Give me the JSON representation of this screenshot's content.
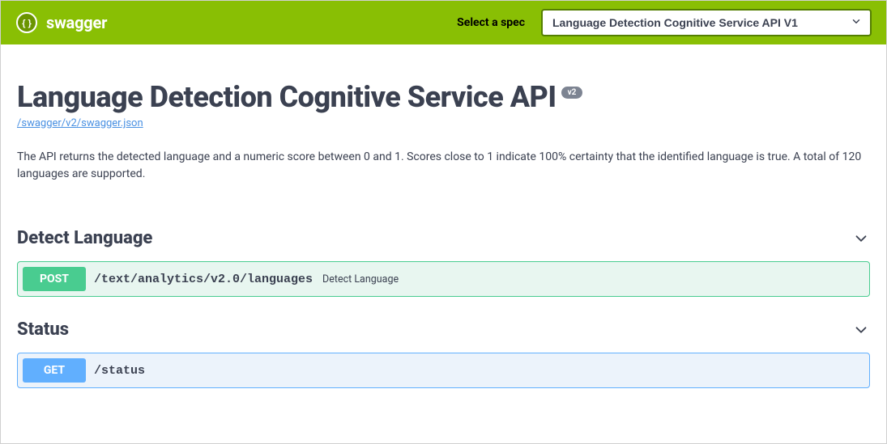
{
  "topbar": {
    "brand": "swagger",
    "spec_label": "Select a spec",
    "spec_selected": "Language Detection Cognitive Service API V1"
  },
  "info": {
    "title": "Language Detection Cognitive Service API",
    "version": "v2",
    "swagger_json_url": "/swagger/v2/swagger.json",
    "description": "The API returns the detected language and a numeric score between 0 and 1. Scores close to 1 indicate 100% certainty that the identified language is true. A total of 120 languages are supported."
  },
  "tags": [
    {
      "name": "Detect Language",
      "operations": [
        {
          "method": "POST",
          "path": "/text/analytics/v2.0/languages",
          "summary": "Detect Language"
        }
      ]
    },
    {
      "name": "Status",
      "operations": [
        {
          "method": "GET",
          "path": "/status",
          "summary": ""
        }
      ]
    }
  ]
}
